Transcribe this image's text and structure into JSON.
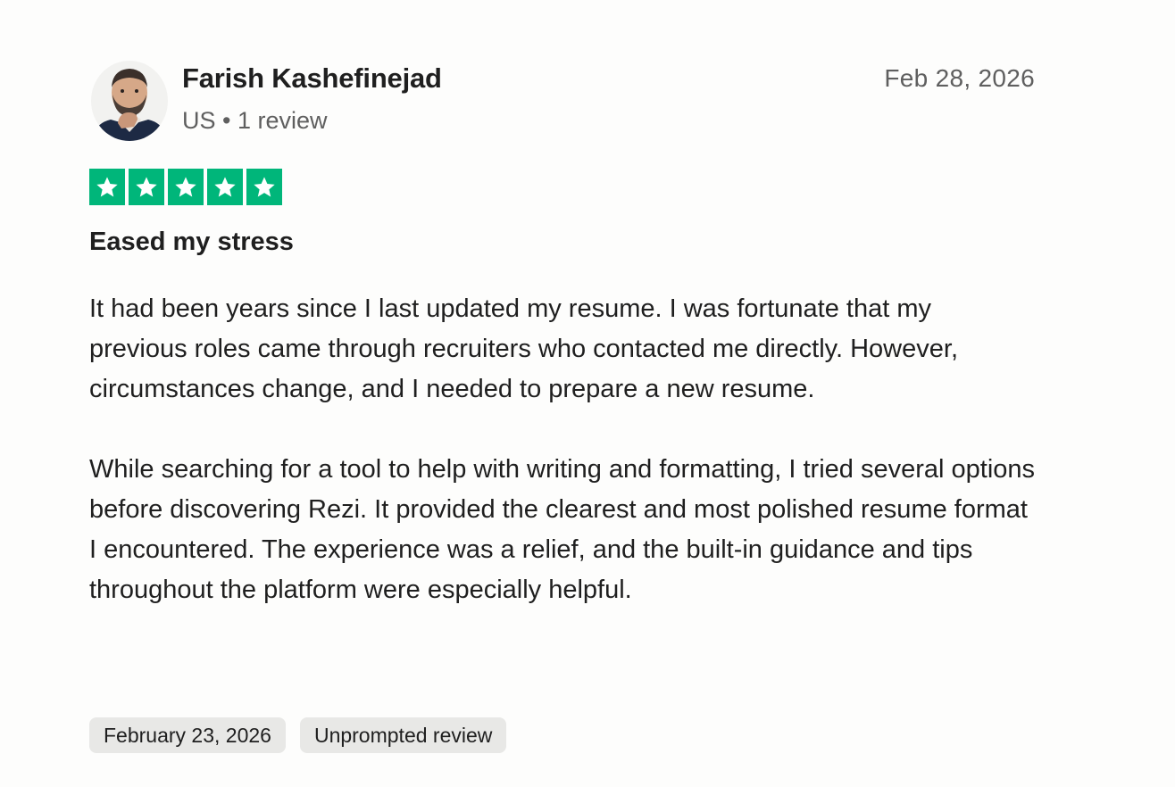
{
  "reviewer": {
    "name": "Farish Kashefinejad",
    "country": "US",
    "separator": "•",
    "review_count": "1 review",
    "avatar_icon": "person-photo-avatar"
  },
  "review": {
    "date": "Feb 28, 2026",
    "rating": 5,
    "rating_color": "#00b67a",
    "star_icon": "star-icon",
    "title": "Eased my stress",
    "paragraphs": [
      "It had been years since I last updated my resume. I was fortunate that my previous roles came through recruiters who contacted me directly. However, circumstances change, and I needed to prepare a new resume.",
      "While searching for a tool to help with writing and formatting, I tried several options before discovering Rezi. It provided the clearest and most polished resume format I encountered. The experience was a relief, and the built-in guidance and tips throughout the platform were especially helpful."
    ]
  },
  "tags": {
    "experience_date": "February 23, 2026",
    "review_type": "Unprompted review"
  }
}
